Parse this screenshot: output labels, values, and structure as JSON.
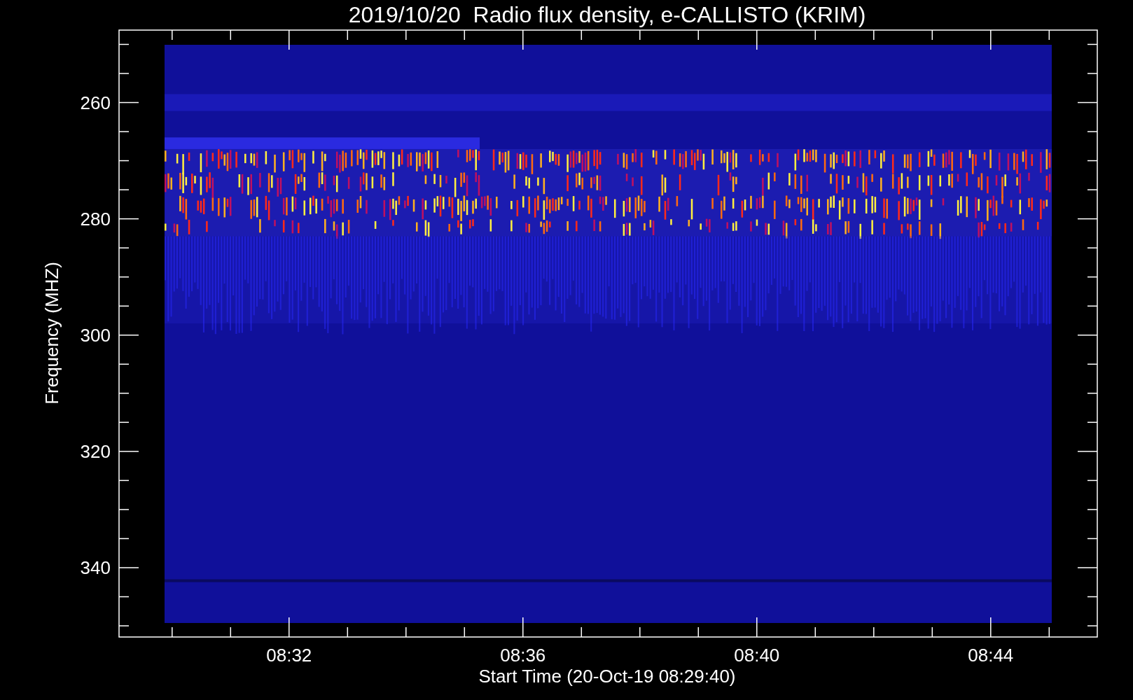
{
  "title": "2019/10/20  Radio flux density, e-CALLISTO (KRIM)",
  "y_axis": {
    "label": "Frequency (MHZ)",
    "ticks": [
      "260",
      "280",
      "300",
      "320",
      "340"
    ]
  },
  "x_axis": {
    "label": "Start Time (20-Oct-19 08:29:40)",
    "ticks": [
      "08:32",
      "08:36",
      "08:40",
      "08:44"
    ]
  }
}
